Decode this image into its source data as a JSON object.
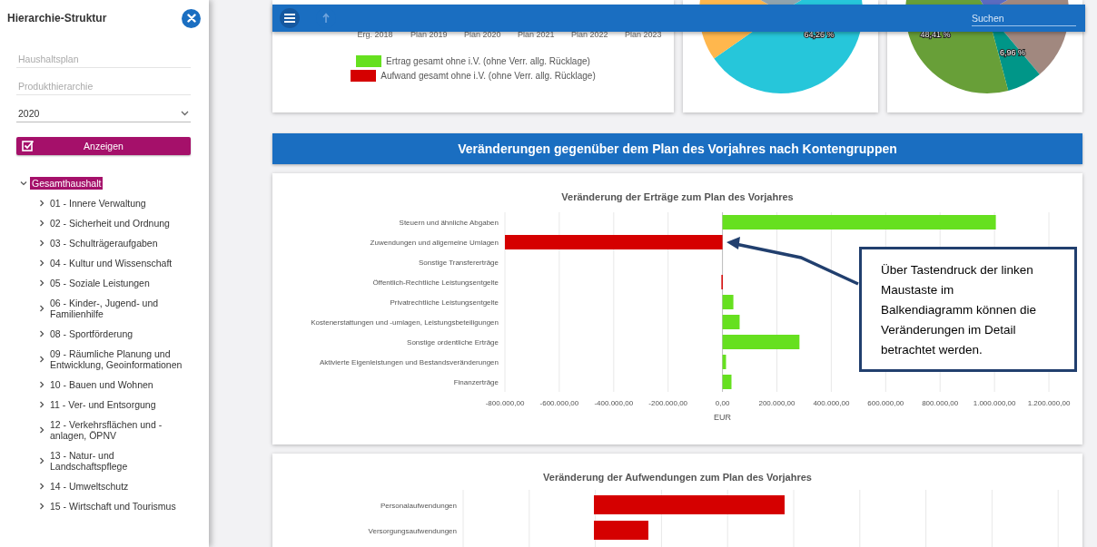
{
  "sidebar": {
    "title": "Hierarchie-Struktur",
    "fields": [
      {
        "placeholder": "Haushaltsplan"
      },
      {
        "placeholder": "Produkthierarchie"
      }
    ],
    "year_select": {
      "value": "2020"
    },
    "show_button": {
      "label": "Anzeigen"
    },
    "tree": [
      {
        "label": "Gesamthaushalt",
        "expanded": true,
        "selected": true,
        "children": [
          {
            "label": "01 - Innere Verwaltung",
            "expanded": false,
            "selected": false
          },
          {
            "label": "02 - Sicherheit und Ordnung",
            "expanded": false,
            "selected": false
          },
          {
            "label": "03 - Schulträgeraufgaben",
            "expanded": false,
            "selected": false
          },
          {
            "label": "04 - Kultur und Wissenschaft",
            "expanded": false,
            "selected": false
          },
          {
            "label": "05 - Soziale Leistungen",
            "expanded": false,
            "selected": false
          },
          {
            "label": "06 - Kinder-, Jugend- und Familienhilfe",
            "expanded": false,
            "selected": false
          },
          {
            "label": "08 - Sportförderung",
            "expanded": false,
            "selected": false
          },
          {
            "label": "09 - Räumliche Planung und Entwicklung, Geoinformationen",
            "expanded": false,
            "selected": false
          },
          {
            "label": "10 - Bauen und Wohnen",
            "expanded": false,
            "selected": false
          },
          {
            "label": "11 - Ver- und Entsorgung",
            "expanded": false,
            "selected": false
          },
          {
            "label": "12 - Verkehrsflächen und -anlagen, ÖPNV",
            "expanded": false,
            "selected": false
          },
          {
            "label": "13 - Natur- und Landschaftspflege",
            "expanded": false,
            "selected": false
          },
          {
            "label": "14 - Umweltschutz",
            "expanded": false,
            "selected": false
          },
          {
            "label": "15 - Wirtschaft und Tourismus",
            "expanded": false,
            "selected": false
          }
        ]
      }
    ]
  },
  "top_bar": {
    "search": {
      "placeholder": "Suchen"
    }
  },
  "overview_cards": [
    {
      "kind": "legend_chart",
      "x_labels": [
        "Erg. 2018",
        "Plan 2019",
        "Plan 2020",
        "Plan 2021",
        "Plan 2022",
        "Plan 2023"
      ],
      "legend": [
        {
          "label": "Ertrag gesamt ohne i.V. (ohne Verr. allg. Rücklage)",
          "color": "#66e01f"
        },
        {
          "label": "Aufwand gesamt ohne i.V. (ohne Verr. allg. Rücklage)",
          "color": "#d50000"
        }
      ]
    },
    {
      "kind": "pie",
      "slice_labels": [
        "64,26 %"
      ]
    },
    {
      "kind": "pie",
      "slice_labels": [
        "48,41 %",
        "6,96 %"
      ]
    }
  ],
  "section_header": "Veränderungen gegenüber dem Plan des Vorjahres nach Kontengruppen",
  "income_chart": {
    "chart_data": {
      "type": "bar",
      "orientation": "horizontal",
      "grid": true,
      "title": "Veränderung der Erträge zum Plan des Vorjahres",
      "xlabel": "EUR",
      "categories": [
        "Steuern und ähnliche Abgaben",
        "Zuwendungen und allgemeine Umlagen",
        "Sonstige Transfererträge",
        "Öffentlich-Rechtliche Leistungsentgelte",
        "Privatrechtliche Leistungsentgelte",
        "Kostenerstattungen und -umlagen, Leistungsbeteiligungen",
        "Sonstige ordentliche Erträge",
        "Aktivierte Eigenleistungen und Bestandsveränderungen",
        "Finanzerträge"
      ],
      "series": [
        {
          "color": "#66e01f",
          "values": [
            1005000,
            null,
            0,
            null,
            40000,
            63000,
            283000,
            13000,
            33000
          ]
        },
        {
          "color": "#d50000",
          "values": [
            null,
            -800000,
            null,
            -4000,
            null,
            null,
            null,
            null,
            null
          ]
        }
      ],
      "xlim": [
        -800000,
        1200000
      ],
      "xticks": [
        {
          "value": -800000,
          "label": "-800.000,00"
        },
        {
          "value": -600000,
          "label": "-600.000,00"
        },
        {
          "value": -400000,
          "label": "-400.000,00"
        },
        {
          "value": -200000,
          "label": "-200.000,00"
        },
        {
          "value": 0,
          "label": "0,00"
        },
        {
          "value": 200000,
          "label": "200.000,00"
        },
        {
          "value": 400000,
          "label": "400.000,00"
        },
        {
          "value": 600000,
          "label": "600.000,00"
        },
        {
          "value": 800000,
          "label": "800.000,00"
        },
        {
          "value": 1000000,
          "label": "1.000.000,00"
        },
        {
          "value": 1200000,
          "label": "1.200.000,00"
        }
      ]
    }
  },
  "callout": {
    "text": "Über Tastendruck der linken\nMaustaste im\nBalkendiagramm können die\nVeränderungen im Detail\nbetrachtet werden."
  },
  "expense_chart": {
    "title": "Veränderung der Aufwendungen zum Plan des Vorjahres",
    "categories": [
      "Personalaufwendungen",
      "Versorgungsaufwendungen"
    ]
  }
}
